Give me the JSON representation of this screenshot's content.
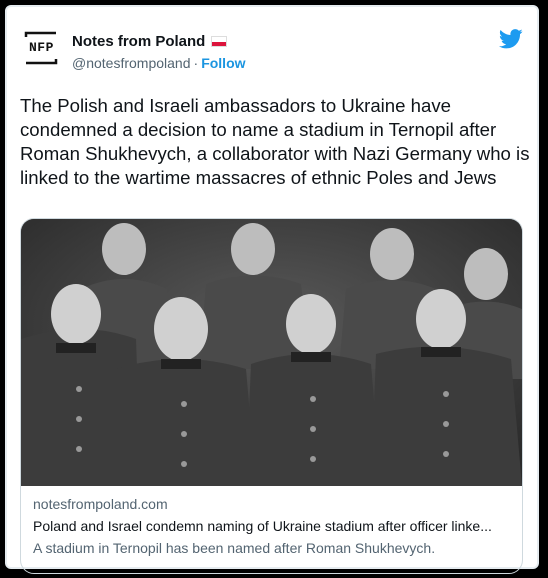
{
  "account": {
    "logo_text": "NFP",
    "display_name": "Notes from Poland",
    "flag": "poland-flag",
    "handle": "@notesfrompoland",
    "separator": "·",
    "follow_label": "Follow"
  },
  "platform_icon": "twitter-bird-icon",
  "tweet": {
    "text": "The Polish and Israeli ambassadors to Ukraine have condemned a decision to name a stadium in Ternopil after Roman Shukhevych, a collaborator with Nazi Germany who is linked to the wartime massacres of ethnic Poles and Jews"
  },
  "card": {
    "image": "black-and-white group photo of nine men in military uniforms",
    "domain": "notesfrompoland.com",
    "title": "Poland and Israel condemn naming of Ukraine stadium after officer linke...",
    "description": "A stadium in Ternopil has been named after Roman Shukhevych."
  },
  "colors": {
    "follow": "#1b95e0",
    "twitter_blue": "#1d9bf0",
    "secondary_text": "#536471",
    "flag_red": "#dc143c"
  }
}
